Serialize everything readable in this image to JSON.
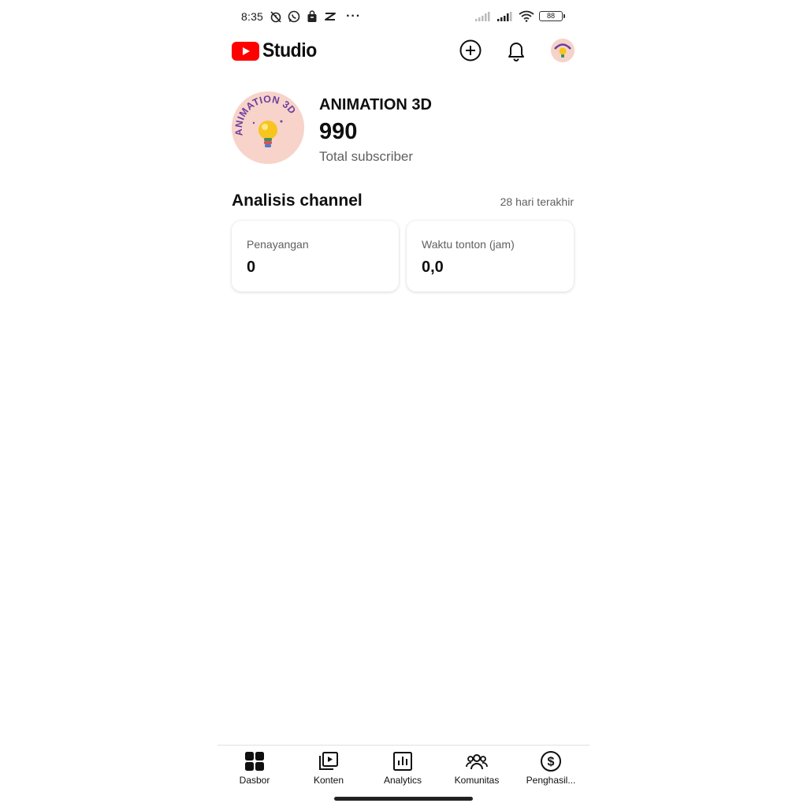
{
  "status_bar": {
    "time": "8:35",
    "icons": [
      "alarm-off-icon",
      "whatsapp-icon",
      "shop-bag-icon",
      "capcut-icon",
      "more-dots-icon"
    ],
    "more": "···",
    "battery": "88"
  },
  "header": {
    "logo_text": "Studio",
    "brand_color": "#ff0000",
    "actions": [
      "add-circle-icon",
      "bell-icon",
      "avatar"
    ]
  },
  "channel": {
    "name": "ANIMATION 3D",
    "subscribers": "990",
    "subscribers_label": "Total subscriber",
    "avatar_text": "ANIMATION 3D"
  },
  "analytics": {
    "title": "Analisis channel",
    "range": "28 hari terakhir",
    "cards": [
      {
        "label": "Penayangan",
        "value": "0"
      },
      {
        "label": "Waktu tonton (jam)",
        "value": "0,0"
      }
    ]
  },
  "nav": {
    "items": [
      {
        "label": "Dasbor",
        "icon": "dashboard-icon"
      },
      {
        "label": "Konten",
        "icon": "content-icon"
      },
      {
        "label": "Analytics",
        "icon": "analytics-icon"
      },
      {
        "label": "Komunitas",
        "icon": "community-icon"
      },
      {
        "label": "Penghasil...",
        "icon": "earn-icon"
      }
    ]
  }
}
